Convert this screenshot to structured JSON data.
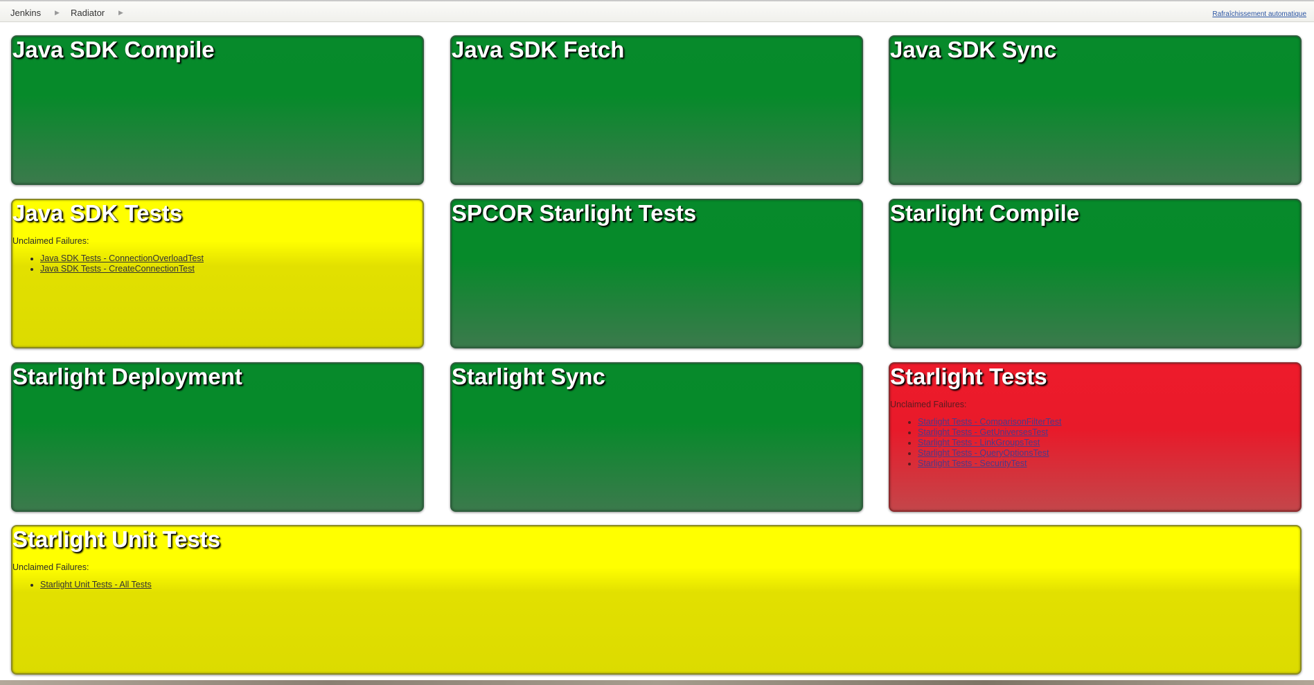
{
  "breadcrumbs": [
    {
      "label": "Jenkins"
    },
    {
      "label": "Radiator"
    }
  ],
  "autorefresh_label": "Rafraîchissement automatique",
  "jobs": [
    {
      "name": "Java SDK Compile",
      "status": "green"
    },
    {
      "name": "Java SDK Fetch",
      "status": "green"
    },
    {
      "name": "Java SDK Sync",
      "status": "green"
    },
    {
      "name": "Java SDK Tests",
      "status": "yellow",
      "failures_label": "Unclaimed Failures:",
      "failures": [
        "Java SDK Tests - ConnectionOverloadTest",
        "Java SDK Tests - CreateConnectionTest"
      ]
    },
    {
      "name": "SPCOR Starlight Tests",
      "status": "green"
    },
    {
      "name": "Starlight Compile",
      "status": "green"
    },
    {
      "name": "Starlight Deployment",
      "status": "green"
    },
    {
      "name": "Starlight Sync",
      "status": "green"
    },
    {
      "name": "Starlight Tests",
      "status": "red",
      "failures_label": "Unclaimed Failures:",
      "failures": [
        "Starlight Tests - ComparisonFilterTest",
        "Starlight Tests - GetUniversesTest",
        "Starlight Tests - LinkGroupsTest",
        "Starlight Tests - QueryOptionsTest",
        "Starlight Tests - SecurityTest"
      ]
    },
    {
      "name": "Starlight Unit Tests",
      "status": "yellow",
      "failures_label": "Unclaimed Failures:",
      "failures": [
        "Starlight Unit Tests - All Tests"
      ]
    }
  ],
  "colors": {
    "success": "#078a2b",
    "unstable": "#ffff00",
    "failure": "#ee1b2b"
  }
}
